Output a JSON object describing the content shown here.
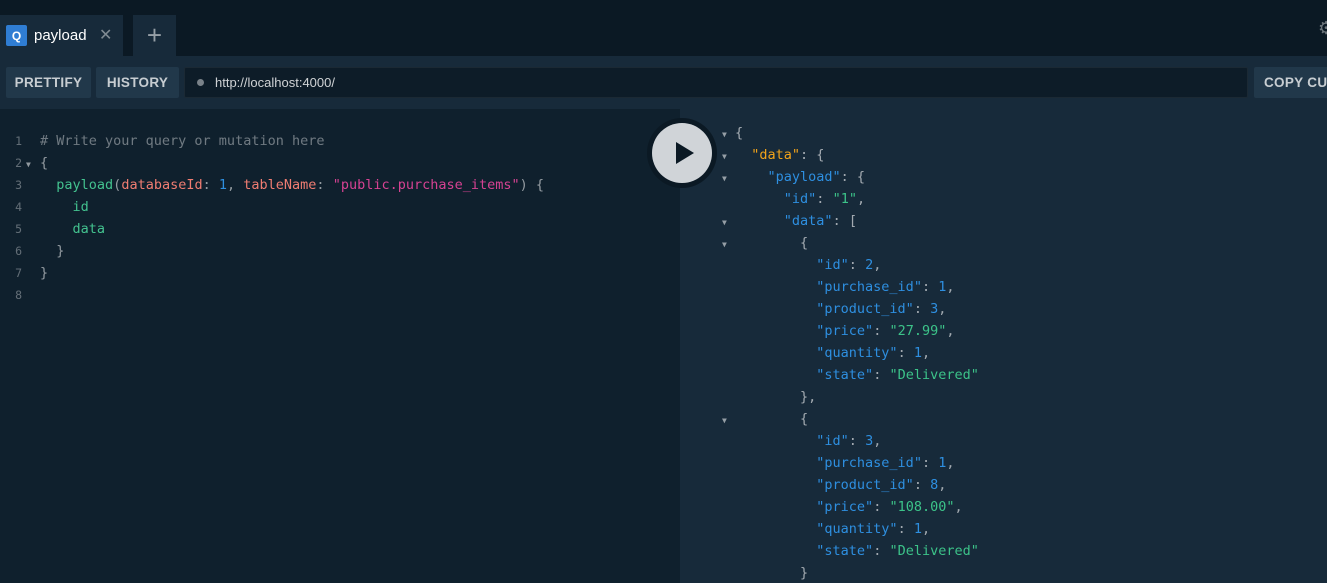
{
  "tabs": [
    {
      "badge": "Q",
      "title": "payload",
      "close": "✕"
    }
  ],
  "tab_add": "+",
  "toolbar": {
    "prettify": "PRETTIFY",
    "history": "HISTORY",
    "url": "http://localhost:4000/",
    "copy": "COPY CURL"
  },
  "editor": {
    "line_numbers": [
      "1",
      "2",
      "3",
      "4",
      "5",
      "6",
      "7",
      "8"
    ],
    "lines": [
      [
        {
          "t": "# Write your query or mutation here",
          "c": "c-comment"
        }
      ],
      [
        {
          "t": "{",
          "c": "c-punct"
        }
      ],
      [
        {
          "t": "  ",
          "c": "c-punct"
        },
        {
          "t": "payload",
          "c": "c-field"
        },
        {
          "t": "(",
          "c": "c-punct"
        },
        {
          "t": "databaseId",
          "c": "c-attr"
        },
        {
          "t": ": ",
          "c": "c-punct"
        },
        {
          "t": "1",
          "c": "c-number"
        },
        {
          "t": ", ",
          "c": "c-punct"
        },
        {
          "t": "tableName",
          "c": "c-attr"
        },
        {
          "t": ": ",
          "c": "c-punct"
        },
        {
          "t": "\"public.purchase_items\"",
          "c": "c-string"
        },
        {
          "t": ") {",
          "c": "c-punct"
        }
      ],
      [
        {
          "t": "    ",
          "c": "c-punct"
        },
        {
          "t": "id",
          "c": "c-field"
        }
      ],
      [
        {
          "t": "    ",
          "c": "c-punct"
        },
        {
          "t": "data",
          "c": "c-field"
        }
      ],
      [
        {
          "t": "  }",
          "c": "c-punct"
        }
      ],
      [
        {
          "t": "}",
          "c": "c-punct"
        }
      ],
      []
    ]
  },
  "result": {
    "lines": [
      [
        {
          "t": "{",
          "c": "j-punct"
        }
      ],
      [
        {
          "t": "  ",
          "c": "j-punct"
        },
        {
          "t": "\"data\"",
          "c": "j-key-top"
        },
        {
          "t": ": {",
          "c": "j-punct"
        }
      ],
      [
        {
          "t": "    ",
          "c": "j-punct"
        },
        {
          "t": "\"payload\"",
          "c": "j-key"
        },
        {
          "t": ": {",
          "c": "j-punct"
        }
      ],
      [
        {
          "t": "      ",
          "c": "j-punct"
        },
        {
          "t": "\"id\"",
          "c": "j-key"
        },
        {
          "t": ": ",
          "c": "j-punct"
        },
        {
          "t": "\"1\"",
          "c": "j-str"
        },
        {
          "t": ",",
          "c": "j-punct"
        }
      ],
      [
        {
          "t": "      ",
          "c": "j-punct"
        },
        {
          "t": "\"data\"",
          "c": "j-key"
        },
        {
          "t": ": [",
          "c": "j-punct"
        }
      ],
      [
        {
          "t": "        {",
          "c": "j-punct"
        }
      ],
      [
        {
          "t": "          ",
          "c": "j-punct"
        },
        {
          "t": "\"id\"",
          "c": "j-key"
        },
        {
          "t": ": ",
          "c": "j-punct"
        },
        {
          "t": "2",
          "c": "j-num"
        },
        {
          "t": ",",
          "c": "j-punct"
        }
      ],
      [
        {
          "t": "          ",
          "c": "j-punct"
        },
        {
          "t": "\"purchase_id\"",
          "c": "j-key"
        },
        {
          "t": ": ",
          "c": "j-punct"
        },
        {
          "t": "1",
          "c": "j-num"
        },
        {
          "t": ",",
          "c": "j-punct"
        }
      ],
      [
        {
          "t": "          ",
          "c": "j-punct"
        },
        {
          "t": "\"product_id\"",
          "c": "j-key"
        },
        {
          "t": ": ",
          "c": "j-punct"
        },
        {
          "t": "3",
          "c": "j-num"
        },
        {
          "t": ",",
          "c": "j-punct"
        }
      ],
      [
        {
          "t": "          ",
          "c": "j-punct"
        },
        {
          "t": "\"price\"",
          "c": "j-key"
        },
        {
          "t": ": ",
          "c": "j-punct"
        },
        {
          "t": "\"27.99\"",
          "c": "j-str"
        },
        {
          "t": ",",
          "c": "j-punct"
        }
      ],
      [
        {
          "t": "          ",
          "c": "j-punct"
        },
        {
          "t": "\"quantity\"",
          "c": "j-key"
        },
        {
          "t": ": ",
          "c": "j-punct"
        },
        {
          "t": "1",
          "c": "j-num"
        },
        {
          "t": ",",
          "c": "j-punct"
        }
      ],
      [
        {
          "t": "          ",
          "c": "j-punct"
        },
        {
          "t": "\"state\"",
          "c": "j-key"
        },
        {
          "t": ": ",
          "c": "j-punct"
        },
        {
          "t": "\"Delivered\"",
          "c": "j-str"
        }
      ],
      [
        {
          "t": "        },",
          "c": "j-punct"
        }
      ],
      [
        {
          "t": "        {",
          "c": "j-punct"
        }
      ],
      [
        {
          "t": "          ",
          "c": "j-punct"
        },
        {
          "t": "\"id\"",
          "c": "j-key"
        },
        {
          "t": ": ",
          "c": "j-punct"
        },
        {
          "t": "3",
          "c": "j-num"
        },
        {
          "t": ",",
          "c": "j-punct"
        }
      ],
      [
        {
          "t": "          ",
          "c": "j-punct"
        },
        {
          "t": "\"purchase_id\"",
          "c": "j-key"
        },
        {
          "t": ": ",
          "c": "j-punct"
        },
        {
          "t": "1",
          "c": "j-num"
        },
        {
          "t": ",",
          "c": "j-punct"
        }
      ],
      [
        {
          "t": "          ",
          "c": "j-punct"
        },
        {
          "t": "\"product_id\"",
          "c": "j-key"
        },
        {
          "t": ": ",
          "c": "j-punct"
        },
        {
          "t": "8",
          "c": "j-num"
        },
        {
          "t": ",",
          "c": "j-punct"
        }
      ],
      [
        {
          "t": "          ",
          "c": "j-punct"
        },
        {
          "t": "\"price\"",
          "c": "j-key"
        },
        {
          "t": ": ",
          "c": "j-punct"
        },
        {
          "t": "\"108.00\"",
          "c": "j-str"
        },
        {
          "t": ",",
          "c": "j-punct"
        }
      ],
      [
        {
          "t": "          ",
          "c": "j-punct"
        },
        {
          "t": "\"quantity\"",
          "c": "j-key"
        },
        {
          "t": ": ",
          "c": "j-punct"
        },
        {
          "t": "1",
          "c": "j-num"
        },
        {
          "t": ",",
          "c": "j-punct"
        }
      ],
      [
        {
          "t": "          ",
          "c": "j-punct"
        },
        {
          "t": "\"state\"",
          "c": "j-key"
        },
        {
          "t": ": ",
          "c": "j-punct"
        },
        {
          "t": "\"Delivered\"",
          "c": "j-str"
        }
      ],
      [
        {
          "t": "        }",
          "c": "j-punct"
        }
      ]
    ]
  },
  "icons": {
    "run": "play-icon",
    "fold": "triangle-down-icon",
    "settings": "gear-icon"
  },
  "colors": {
    "accent": "#2f7dd3",
    "background": "#0b1924",
    "panel": "#172a3a",
    "editor": "#0f202d"
  }
}
